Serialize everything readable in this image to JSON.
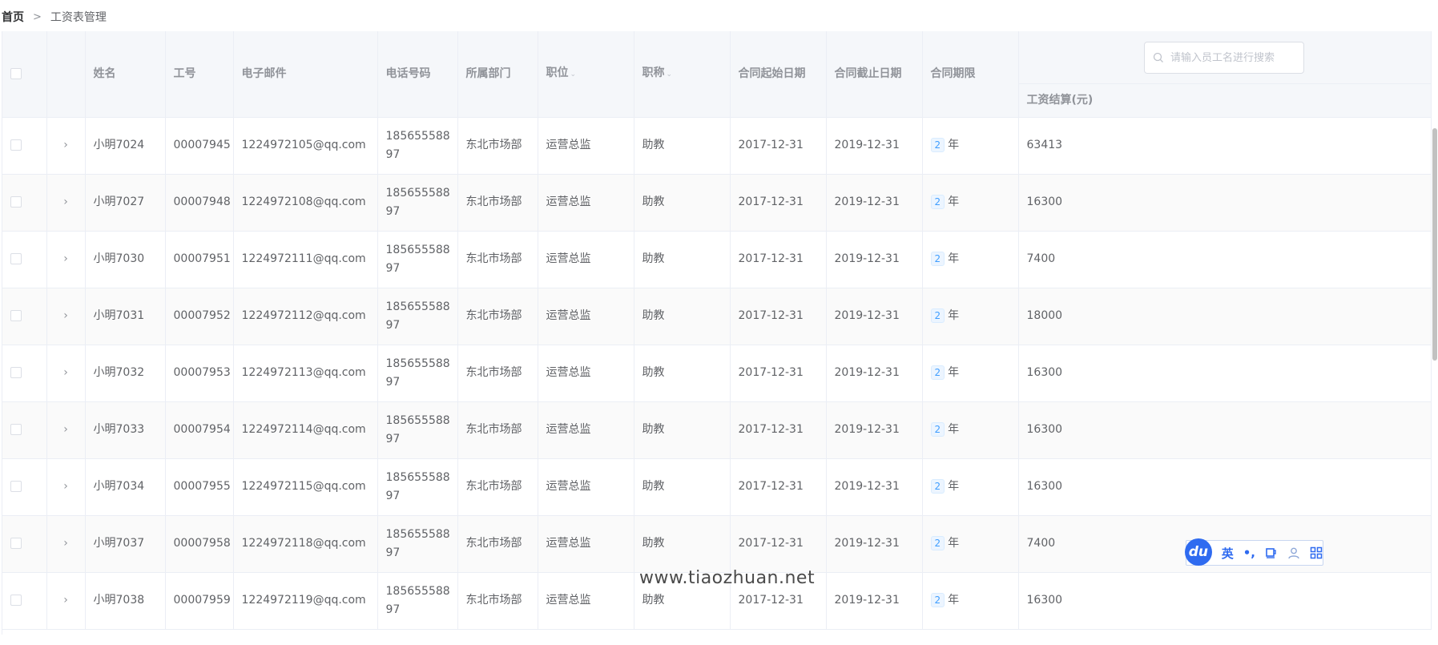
{
  "breadcrumb": {
    "home": "首页",
    "separator": ">",
    "current": "工资表管理"
  },
  "search": {
    "placeholder": "请输入员工名进行搜索",
    "value": ""
  },
  "table": {
    "headers": {
      "name": "姓名",
      "id": "工号",
      "email": "电子邮件",
      "phone": "电话号码",
      "dept": "所属部门",
      "position": "职位",
      "title": "职称",
      "start": "合同起始日期",
      "end": "合同截止日期",
      "term": "合同期限",
      "salary": "工资结算(元)"
    },
    "sort_caret": "⌄",
    "expand_icon": "›",
    "term_unit": "年",
    "rows": [
      {
        "name": "小明7024",
        "id": "00007945",
        "email": "1224972105@qq.com",
        "phone": "18565558897",
        "dept": "东北市场部",
        "position": "运营总监",
        "title": "助教",
        "start": "2017-12-31",
        "end": "2019-12-31",
        "term": "2",
        "salary": "63413"
      },
      {
        "name": "小明7027",
        "id": "00007948",
        "email": "1224972108@qq.com",
        "phone": "18565558897",
        "dept": "东北市场部",
        "position": "运营总监",
        "title": "助教",
        "start": "2017-12-31",
        "end": "2019-12-31",
        "term": "2",
        "salary": "16300"
      },
      {
        "name": "小明7030",
        "id": "00007951",
        "email": "1224972111@qq.com",
        "phone": "18565558897",
        "dept": "东北市场部",
        "position": "运营总监",
        "title": "助教",
        "start": "2017-12-31",
        "end": "2019-12-31",
        "term": "2",
        "salary": "7400"
      },
      {
        "name": "小明7031",
        "id": "00007952",
        "email": "1224972112@qq.com",
        "phone": "18565558897",
        "dept": "东北市场部",
        "position": "运营总监",
        "title": "助教",
        "start": "2017-12-31",
        "end": "2019-12-31",
        "term": "2",
        "salary": "18000"
      },
      {
        "name": "小明7032",
        "id": "00007953",
        "email": "1224972113@qq.com",
        "phone": "18565558897",
        "dept": "东北市场部",
        "position": "运营总监",
        "title": "助教",
        "start": "2017-12-31",
        "end": "2019-12-31",
        "term": "2",
        "salary": "16300"
      },
      {
        "name": "小明7033",
        "id": "00007954",
        "email": "1224972114@qq.com",
        "phone": "18565558897",
        "dept": "东北市场部",
        "position": "运营总监",
        "title": "助教",
        "start": "2017-12-31",
        "end": "2019-12-31",
        "term": "2",
        "salary": "16300"
      },
      {
        "name": "小明7034",
        "id": "00007955",
        "email": "1224972115@qq.com",
        "phone": "18565558897",
        "dept": "东北市场部",
        "position": "运营总监",
        "title": "助教",
        "start": "2017-12-31",
        "end": "2019-12-31",
        "term": "2",
        "salary": "16300"
      },
      {
        "name": "小明7037",
        "id": "00007958",
        "email": "1224972118@qq.com",
        "phone": "18565558897",
        "dept": "东北市场部",
        "position": "运营总监",
        "title": "助教",
        "start": "2017-12-31",
        "end": "2019-12-31",
        "term": "2",
        "salary": "7400"
      },
      {
        "name": "小明7038",
        "id": "00007959",
        "email": "1224972119@qq.com",
        "phone": "18565558897",
        "dept": "东北市场部",
        "position": "运营总监",
        "title": "助教",
        "start": "2017-12-31",
        "end": "2019-12-31",
        "term": "2",
        "salary": "16300"
      }
    ]
  },
  "ime_toolbar": {
    "logo": "du",
    "lang": "英",
    "punct": "•,",
    "icons": [
      "cup-icon",
      "user-icon",
      "grid-icon"
    ]
  },
  "watermark": "www.tiaozhuan.net",
  "colors": {
    "header_bg": "#f5f7fa",
    "border": "#ebeef5",
    "tag_bg": "#ecf5ff",
    "tag_text": "#409eff",
    "ime_blue": "#2f6bf0"
  }
}
